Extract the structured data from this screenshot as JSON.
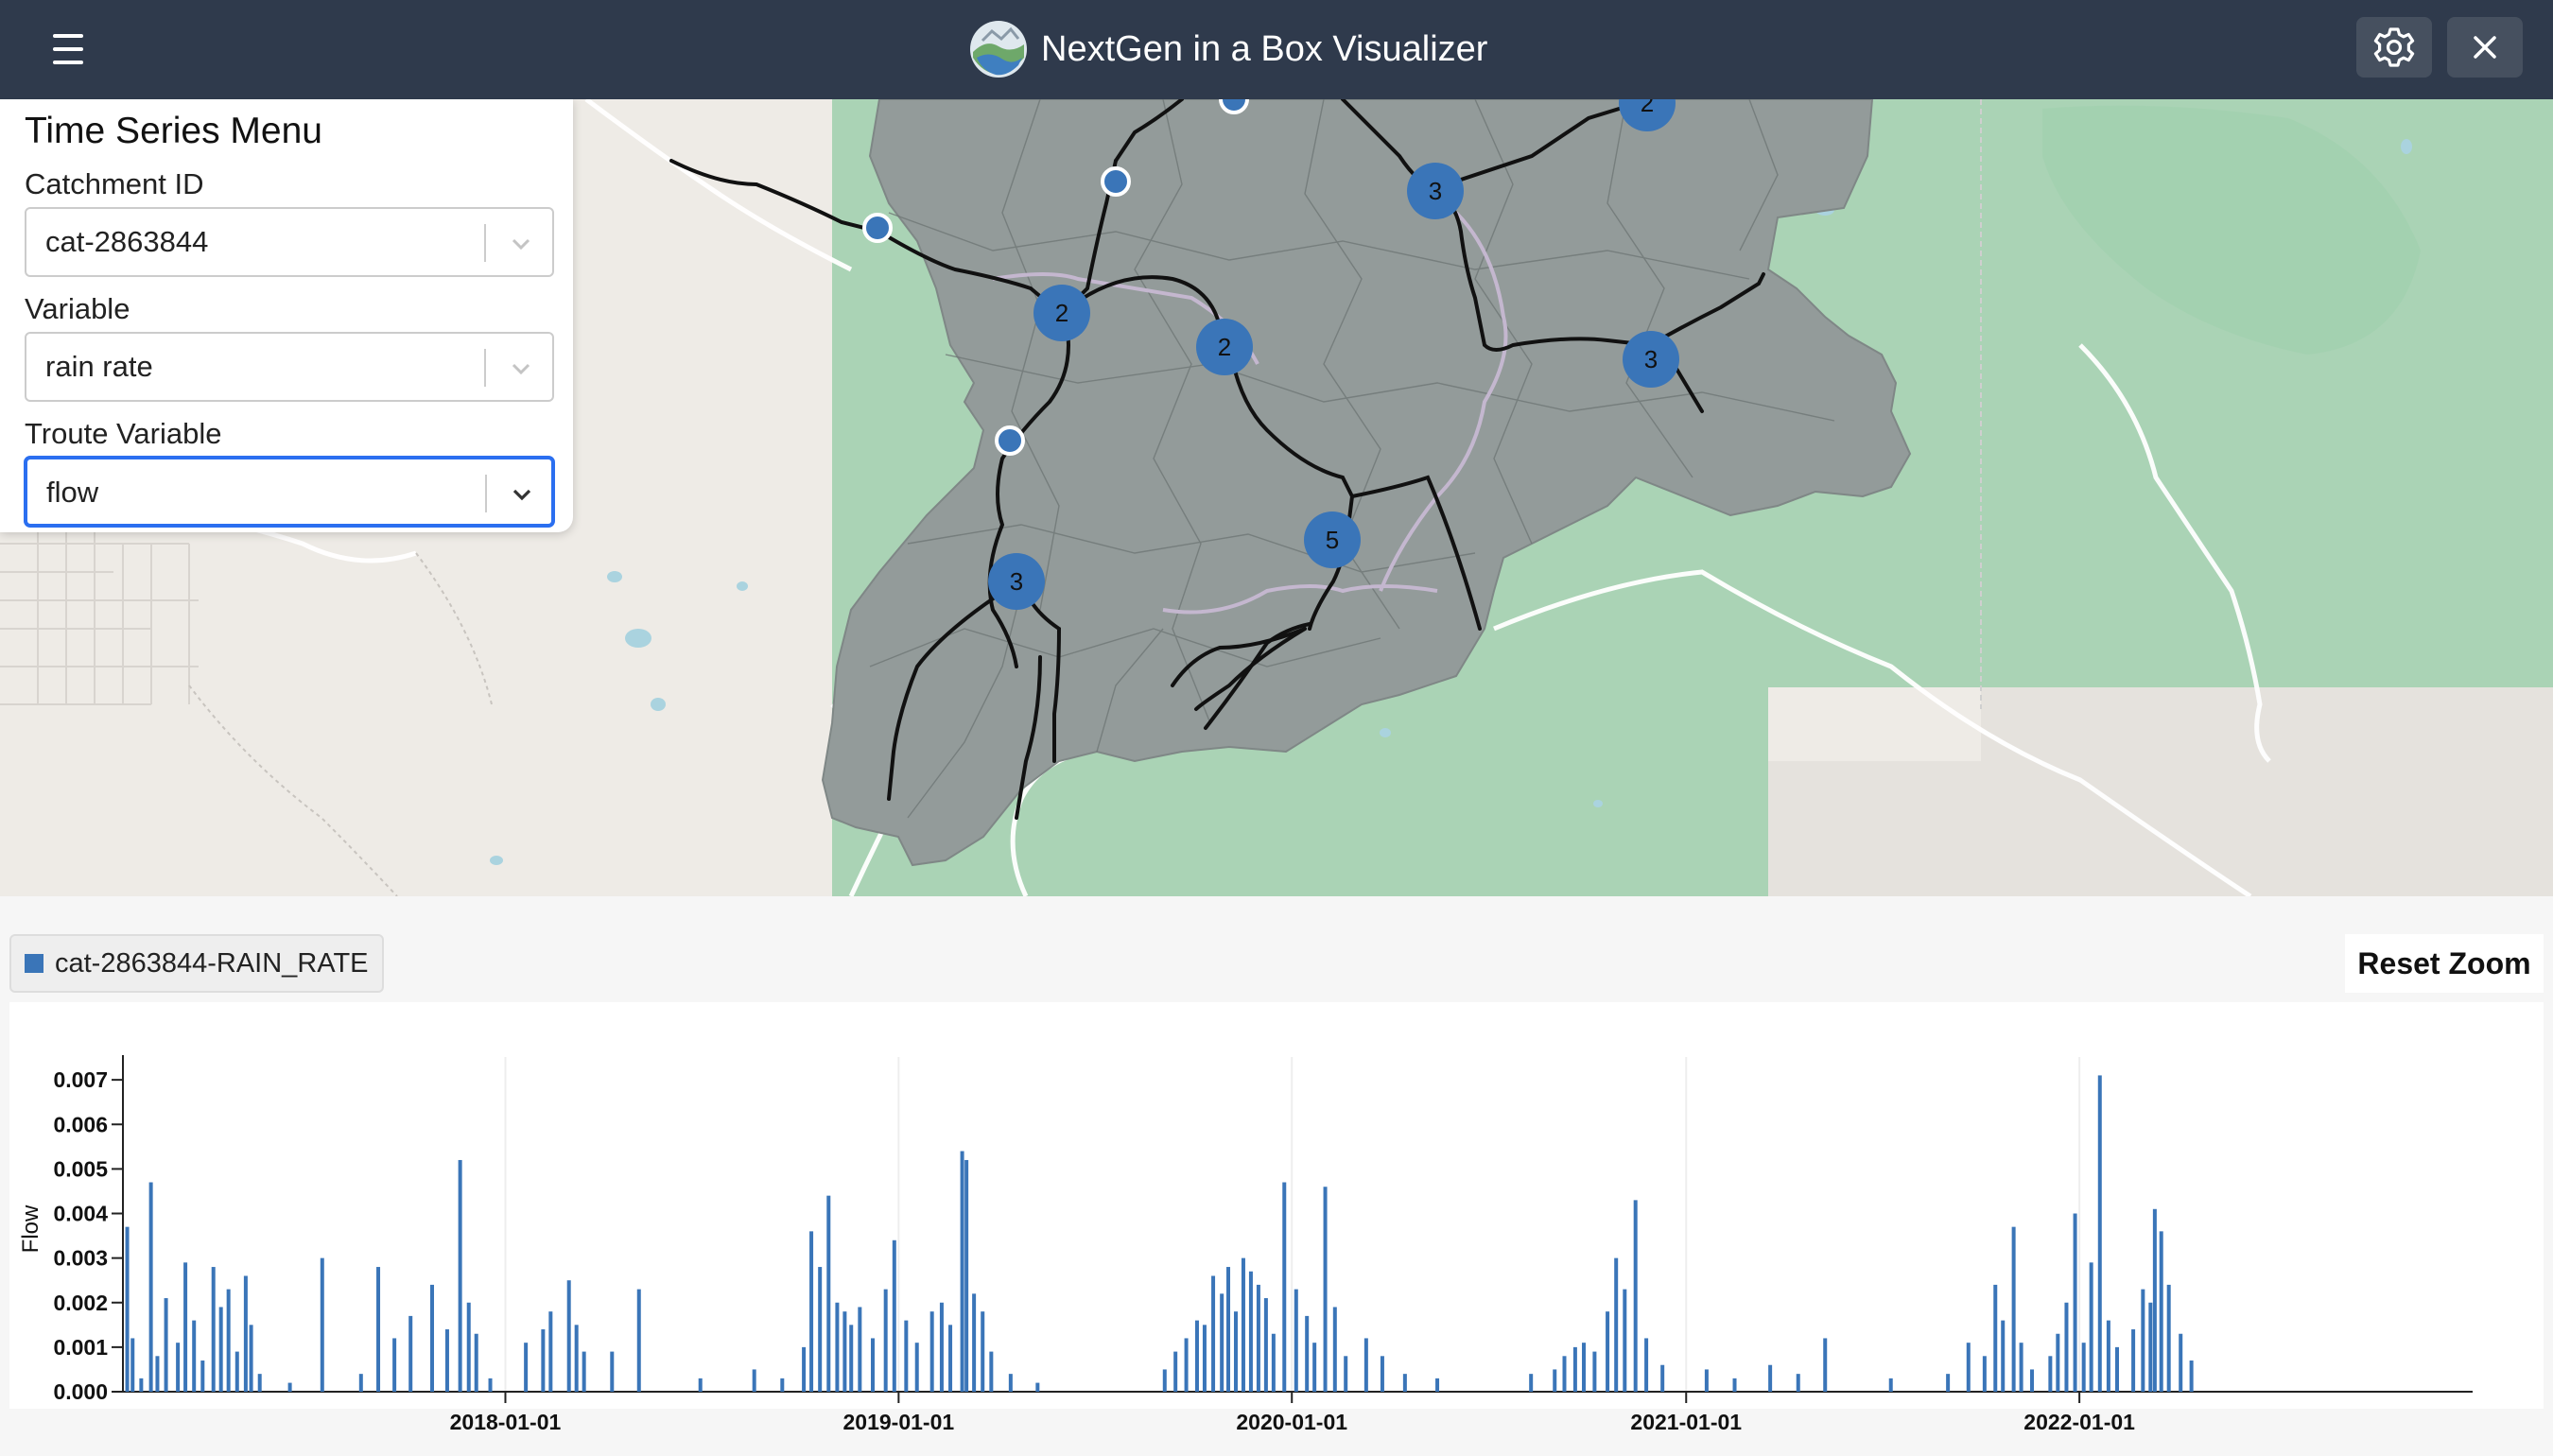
{
  "header": {
    "title": "NextGen in a Box Visualizer",
    "menu_icon": "hamburger-menu-icon",
    "settings_icon": "gear-icon",
    "close_icon": "close-icon",
    "background_color": "#2f3a4c"
  },
  "time_series_menu": {
    "title": "Time Series Menu",
    "catchment": {
      "label": "Catchment ID",
      "value": "cat-2863844"
    },
    "variable": {
      "label": "Variable",
      "value": "rain rate"
    },
    "troute_variable": {
      "label": "Troute Variable",
      "value": "flow"
    }
  },
  "map": {
    "nexus_clusters": [
      {
        "count": "2"
      },
      {
        "count": "3"
      },
      {
        "count": "2"
      },
      {
        "count": "2"
      },
      {
        "count": "3"
      },
      {
        "count": "5"
      },
      {
        "count": "3"
      }
    ],
    "colors": {
      "catchment": "#939b9a",
      "forest": "#aad3b5",
      "marker": "#3a75b8"
    }
  },
  "chart": {
    "legend_label": "cat-2863844-RAIN_RATE",
    "reset_zoom_label": "Reset Zoom"
  },
  "chart_data": {
    "type": "bar",
    "ylabel": "Flow",
    "xlabel": "",
    "ylim": [
      0,
      0.0073
    ],
    "yticks": [
      "0.000",
      "0.001",
      "0.002",
      "0.003",
      "0.004",
      "0.005",
      "0.006",
      "0.007"
    ],
    "xticks": [
      "2018-01-01",
      "2019-01-01",
      "2020-01-01",
      "2021-01-01",
      "2022-01-01"
    ],
    "xlim": [
      "2017-01-11",
      "2023-01-01"
    ],
    "series": [
      {
        "name": "cat-2863844-RAIN_RATE",
        "color": "#3a75b8",
        "points": [
          [
            "2017-01-15",
            0.0037
          ],
          [
            "2017-01-20",
            0.0012
          ],
          [
            "2017-01-28",
            0.0003
          ],
          [
            "2017-02-06",
            0.0047
          ],
          [
            "2017-02-12",
            0.0008
          ],
          [
            "2017-02-20",
            0.0021
          ],
          [
            "2017-03-03",
            0.0011
          ],
          [
            "2017-03-10",
            0.0029
          ],
          [
            "2017-03-18",
            0.0016
          ],
          [
            "2017-03-26",
            0.0007
          ],
          [
            "2017-04-05",
            0.0028
          ],
          [
            "2017-04-12",
            0.0019
          ],
          [
            "2017-04-19",
            0.0023
          ],
          [
            "2017-04-27",
            0.0009
          ],
          [
            "2017-05-05",
            0.0026
          ],
          [
            "2017-05-10",
            0.0015
          ],
          [
            "2017-05-18",
            0.0004
          ],
          [
            "2017-06-15",
            0.0002
          ],
          [
            "2017-07-15",
            0.003
          ],
          [
            "2017-08-20",
            0.0004
          ],
          [
            "2017-09-05",
            0.0028
          ],
          [
            "2017-09-20",
            0.0012
          ],
          [
            "2017-10-05",
            0.0017
          ],
          [
            "2017-10-25",
            0.0024
          ],
          [
            "2017-11-08",
            0.0014
          ],
          [
            "2017-11-20",
            0.0052
          ],
          [
            "2017-11-28",
            0.002
          ],
          [
            "2017-12-05",
            0.0013
          ],
          [
            "2017-12-18",
            0.0003
          ],
          [
            "2018-01-20",
            0.0011
          ],
          [
            "2018-02-05",
            0.0014
          ],
          [
            "2018-02-12",
            0.0018
          ],
          [
            "2018-03-01",
            0.0025
          ],
          [
            "2018-03-08",
            0.0015
          ],
          [
            "2018-03-15",
            0.0009
          ],
          [
            "2018-04-10",
            0.0009
          ],
          [
            "2018-05-05",
            0.0023
          ],
          [
            "2018-07-01",
            0.0003
          ],
          [
            "2018-08-20",
            0.0005
          ],
          [
            "2018-09-15",
            0.0003
          ],
          [
            "2018-10-05",
            0.001
          ],
          [
            "2018-10-12",
            0.0036
          ],
          [
            "2018-10-20",
            0.0028
          ],
          [
            "2018-10-28",
            0.0044
          ],
          [
            "2018-11-05",
            0.002
          ],
          [
            "2018-11-12",
            0.0018
          ],
          [
            "2018-11-18",
            0.0015
          ],
          [
            "2018-11-26",
            0.0019
          ],
          [
            "2018-12-08",
            0.0012
          ],
          [
            "2018-12-20",
            0.0023
          ],
          [
            "2018-12-28",
            0.0034
          ],
          [
            "2019-01-08",
            0.0016
          ],
          [
            "2019-01-18",
            0.0011
          ],
          [
            "2019-02-01",
            0.0018
          ],
          [
            "2019-02-10",
            0.002
          ],
          [
            "2019-02-18",
            0.0015
          ],
          [
            "2019-03-01",
            0.0054
          ],
          [
            "2019-03-05",
            0.0052
          ],
          [
            "2019-03-12",
            0.0022
          ],
          [
            "2019-03-20",
            0.0018
          ],
          [
            "2019-03-28",
            0.0009
          ],
          [
            "2019-04-15",
            0.0004
          ],
          [
            "2019-05-10",
            0.0002
          ],
          [
            "2019-09-05",
            0.0005
          ],
          [
            "2019-09-15",
            0.0009
          ],
          [
            "2019-09-25",
            0.0012
          ],
          [
            "2019-10-05",
            0.0016
          ],
          [
            "2019-10-12",
            0.0015
          ],
          [
            "2019-10-20",
            0.0026
          ],
          [
            "2019-10-28",
            0.0022
          ],
          [
            "2019-11-03",
            0.0028
          ],
          [
            "2019-11-10",
            0.0018
          ],
          [
            "2019-11-17",
            0.003
          ],
          [
            "2019-11-24",
            0.0027
          ],
          [
            "2019-12-01",
            0.0024
          ],
          [
            "2019-12-08",
            0.0021
          ],
          [
            "2019-12-15",
            0.0013
          ],
          [
            "2019-12-25",
            0.0047
          ],
          [
            "2020-01-05",
            0.0023
          ],
          [
            "2020-01-15",
            0.0017
          ],
          [
            "2020-01-22",
            0.0011
          ],
          [
            "2020-02-01",
            0.0046
          ],
          [
            "2020-02-10",
            0.0019
          ],
          [
            "2020-02-20",
            0.0008
          ],
          [
            "2020-03-10",
            0.0012
          ],
          [
            "2020-03-25",
            0.0008
          ],
          [
            "2020-04-15",
            0.0004
          ],
          [
            "2020-05-15",
            0.0003
          ],
          [
            "2020-08-10",
            0.0004
          ],
          [
            "2020-09-01",
            0.0005
          ],
          [
            "2020-09-10",
            0.0008
          ],
          [
            "2020-09-20",
            0.001
          ],
          [
            "2020-09-28",
            0.0011
          ],
          [
            "2020-10-08",
            0.0009
          ],
          [
            "2020-10-20",
            0.0018
          ],
          [
            "2020-10-28",
            0.003
          ],
          [
            "2020-11-05",
            0.0023
          ],
          [
            "2020-11-15",
            0.0043
          ],
          [
            "2020-11-25",
            0.0012
          ],
          [
            "2020-12-10",
            0.0006
          ],
          [
            "2021-01-20",
            0.0005
          ],
          [
            "2021-02-15",
            0.0003
          ],
          [
            "2021-03-20",
            0.0006
          ],
          [
            "2021-04-15",
            0.0004
          ],
          [
            "2021-05-10",
            0.0012
          ],
          [
            "2021-07-10",
            0.0003
          ],
          [
            "2021-09-01",
            0.0004
          ],
          [
            "2021-09-20",
            0.0011
          ],
          [
            "2021-10-05",
            0.0008
          ],
          [
            "2021-10-15",
            0.0024
          ],
          [
            "2021-10-22",
            0.0016
          ],
          [
            "2021-11-01",
            0.0037
          ],
          [
            "2021-11-08",
            0.0011
          ],
          [
            "2021-11-18",
            0.0005
          ],
          [
            "2021-12-05",
            0.0008
          ],
          [
            "2021-12-12",
            0.0013
          ],
          [
            "2021-12-20",
            0.002
          ],
          [
            "2021-12-28",
            0.004
          ],
          [
            "2022-01-05",
            0.0011
          ],
          [
            "2022-01-12",
            0.0029
          ],
          [
            "2022-01-20",
            0.0071
          ],
          [
            "2022-01-28",
            0.0016
          ],
          [
            "2022-02-05",
            0.001
          ],
          [
            "2022-02-20",
            0.0014
          ],
          [
            "2022-03-01",
            0.0023
          ],
          [
            "2022-03-08",
            0.002
          ],
          [
            "2022-03-12",
            0.0041
          ],
          [
            "2022-03-18",
            0.0036
          ],
          [
            "2022-03-25",
            0.0024
          ],
          [
            "2022-04-05",
            0.0013
          ],
          [
            "2022-04-15",
            0.0007
          ]
        ]
      }
    ]
  }
}
